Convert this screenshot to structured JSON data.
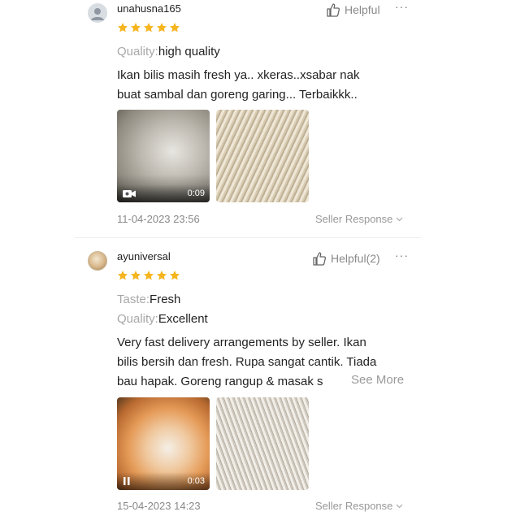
{
  "reviews": [
    {
      "username": "unahusna165",
      "helpful_label": "Helpful",
      "more_label": "···",
      "rating": 5,
      "attributes": [
        {
          "key": "Quality:",
          "value": "high quality"
        }
      ],
      "text_lines": [
        "Ikan bilis masih fresh ya.. xkeras..xsabar nak",
        "buat sambal dan goreng garing... Terbaikkk.."
      ],
      "media": [
        {
          "type": "video",
          "duration": "0:09",
          "icon": "video-camera-icon"
        },
        {
          "type": "image"
        }
      ],
      "timestamp": "11-04-2023 23:56",
      "seller_response_label": "Seller Response"
    },
    {
      "username": "ayuniversal",
      "helpful_label": "Helpful(2)",
      "more_label": "···",
      "rating": 5,
      "attributes": [
        {
          "key": "Taste:",
          "value": "Fresh"
        },
        {
          "key": "Quality:",
          "value": "Excellent"
        }
      ],
      "text_lines": [
        "Very fast delivery arrangements by seller. Ikan",
        "bilis bersih dan fresh. Rupa sangat cantik. Tiada",
        "bau hapak. Goreng rangup & masak s"
      ],
      "see_more_label": "See More",
      "media": [
        {
          "type": "video",
          "duration": "0:03",
          "icon": "pause-icon"
        },
        {
          "type": "image"
        }
      ],
      "timestamp": "15-04-2023 14:23",
      "seller_response_label": "Seller Response"
    }
  ],
  "colors": {
    "star": "#f6b51e",
    "muted_text": "#8a8a8a",
    "divider": "#eeeeee"
  }
}
